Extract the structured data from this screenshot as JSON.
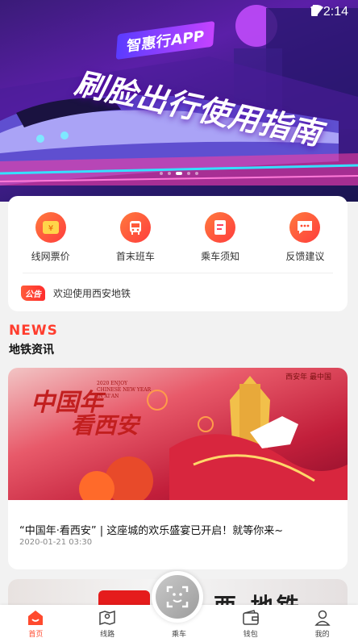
{
  "status": {
    "time": "2:14"
  },
  "banner": {
    "tag": "智惠行APP",
    "title": "刷脸出行使用指南",
    "dots": 5,
    "active_dot": 2
  },
  "menu": {
    "items": [
      {
        "label": "线网票价",
        "icon": "ticket-price-icon"
      },
      {
        "label": "首末班车",
        "icon": "bus-icon"
      },
      {
        "label": "乘车须知",
        "icon": "notice-doc-icon"
      },
      {
        "label": "反馈建议",
        "icon": "chat-feedback-icon"
      }
    ]
  },
  "notice": {
    "badge": "公告",
    "text": "欢迎使用西安地铁"
  },
  "news": {
    "title_en": "NEWS",
    "title_cn": "地铁资讯",
    "articles": [
      {
        "image_text_1": "中国年",
        "image_text_2": "看西安",
        "image_text_en": "2020 ENJOY CHINESE NEW YEAR IN XI'AN",
        "image_logo": "西安年 最中国",
        "title": "“中国年·看西安” | 这座城的欢乐盛宴已开启！就等你来~",
        "date": "2020-01-21 03:30"
      },
      {
        "image_text": "西 地铁"
      }
    ]
  },
  "tabbar": {
    "tabs": [
      {
        "label": "首页",
        "icon": "home-icon",
        "active": true
      },
      {
        "label": "线路",
        "icon": "map-route-icon",
        "active": false
      },
      {
        "label": "乘车",
        "icon": "face-scan-icon",
        "active": false
      },
      {
        "label": "钱包",
        "icon": "wallet-icon",
        "active": false
      },
      {
        "label": "我的",
        "icon": "user-icon",
        "active": false
      }
    ]
  },
  "colors": {
    "accent": "#ff4a2e",
    "banner": "#5b1fa8"
  }
}
